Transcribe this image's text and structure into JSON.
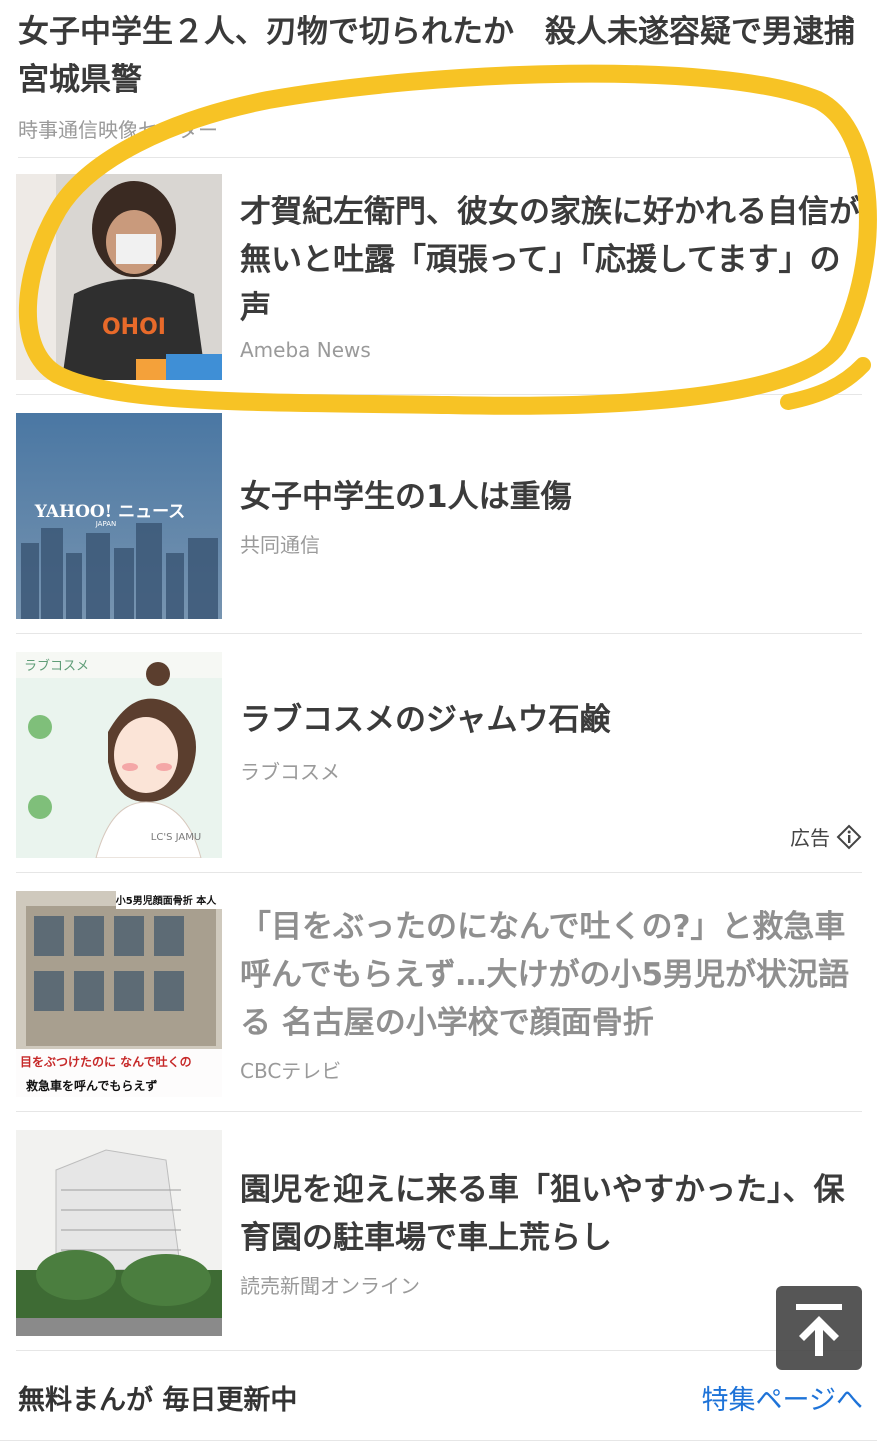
{
  "top_article": {
    "title": "女子中学生２人、刃物で切られたか　殺人未遂容疑で男逮捕　宮城県警",
    "source": "時事通信映像センター"
  },
  "articles": [
    {
      "title": "才賀紀左衛門、彼女の家族に好かれる自信が無いと吐露「頑張って」「応援してます」の声",
      "source": "Ameba News"
    },
    {
      "title": "女子中学生の1人は重傷",
      "source": "共同通信",
      "thumb_text": "YAHOO! ニュース",
      "thumb_sub": "JAPAN"
    },
    {
      "title": "ラブコスメのジャムウ石鹸",
      "source": "ラブコスメ",
      "ad_label": "広告",
      "thumb_text": "ラブコスメ",
      "thumb_logo": "LC'S JAMU"
    },
    {
      "title": "「目をぶったのになんで吐くの?」と救急車呼んでもらえず…大けがの小5男児が状況語る 名古屋の小学校で顔面骨折",
      "source": "CBCテレビ",
      "thumb_caption_top": "小5男児顔面骨折 本人",
      "thumb_caption_1": "目をぶつけたのに なんで吐くの",
      "thumb_caption_2": "救急車を呼んでもらえず"
    },
    {
      "title": "園児を迎えに来る車「狙いやすかった」、保育園の駐車場で車上荒らし",
      "source": "読売新聞オンライン"
    }
  ],
  "footer": {
    "left_label": "無料まんが 毎日更新中",
    "right_link": "特集ページへ"
  },
  "colors": {
    "highlight": "#f7c325",
    "link": "#1e73d8",
    "scroll_button": "#4d4d4d"
  },
  "icons": {
    "info": "info-diamond-icon",
    "scroll_top": "arrow-up-bar-icon"
  }
}
